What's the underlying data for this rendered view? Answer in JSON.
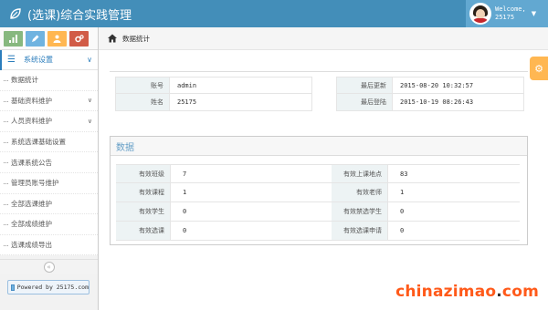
{
  "app": {
    "title": "(选课)综合实践管理"
  },
  "user": {
    "welcome": "Welcome,",
    "name": "25175"
  },
  "shortcuts": [
    {
      "icon": "signal-icon",
      "color": "#87b87f"
    },
    {
      "icon": "pencil-icon",
      "color": "#6fb3e0"
    },
    {
      "icon": "users-icon",
      "color": "#ffb752"
    },
    {
      "icon": "cogs-icon",
      "color": "#d15b47"
    }
  ],
  "sidebar": {
    "parent_label": "系统设置",
    "items": [
      {
        "label": "数据统计",
        "has_children": false
      },
      {
        "label": "基础资料维护",
        "has_children": true
      },
      {
        "label": "人员资料维护",
        "has_children": true
      },
      {
        "label": "系统选课基础设置",
        "has_children": false
      },
      {
        "label": "选课系统公告",
        "has_children": false
      },
      {
        "label": "管理员账号维护",
        "has_children": false
      },
      {
        "label": "全部选课维护",
        "has_children": false
      },
      {
        "label": "全部成绩维护",
        "has_children": false
      },
      {
        "label": "选课成绩导出",
        "has_children": false
      }
    ],
    "collapse_glyph": "«",
    "powered_by": "Powered by 25175.com"
  },
  "breadcrumb": {
    "current": "数据统计"
  },
  "account_info": {
    "left": [
      {
        "key": "账号",
        "value": "admin"
      },
      {
        "key": "姓名",
        "value": "25175"
      }
    ],
    "right": [
      {
        "key": "最后更新",
        "value": "2015-08-20 10:32:57"
      },
      {
        "key": "最后登陆",
        "value": "2015-10-19 08:26:43"
      }
    ]
  },
  "stats": {
    "title": "数据",
    "left": [
      {
        "key": "有效班级",
        "value": "7"
      },
      {
        "key": "有效课程",
        "value": "1"
      },
      {
        "key": "有效学生",
        "value": "0"
      },
      {
        "key": "有效选课",
        "value": "0"
      }
    ],
    "right": [
      {
        "key": "有效上课地点",
        "value": "83"
      },
      {
        "key": "有效老师",
        "value": "1"
      },
      {
        "key": "有效禁选学生",
        "value": "0"
      },
      {
        "key": "有效选课申请",
        "value": "0"
      }
    ]
  },
  "watermark": {
    "pre": "chinazimao",
    "dot": ".",
    "post": "com"
  },
  "colors": {
    "navbar": "#438eb9",
    "accent": "#2b7dbc",
    "header_text": "#669fc7",
    "watermark": "#ff5a1a"
  }
}
